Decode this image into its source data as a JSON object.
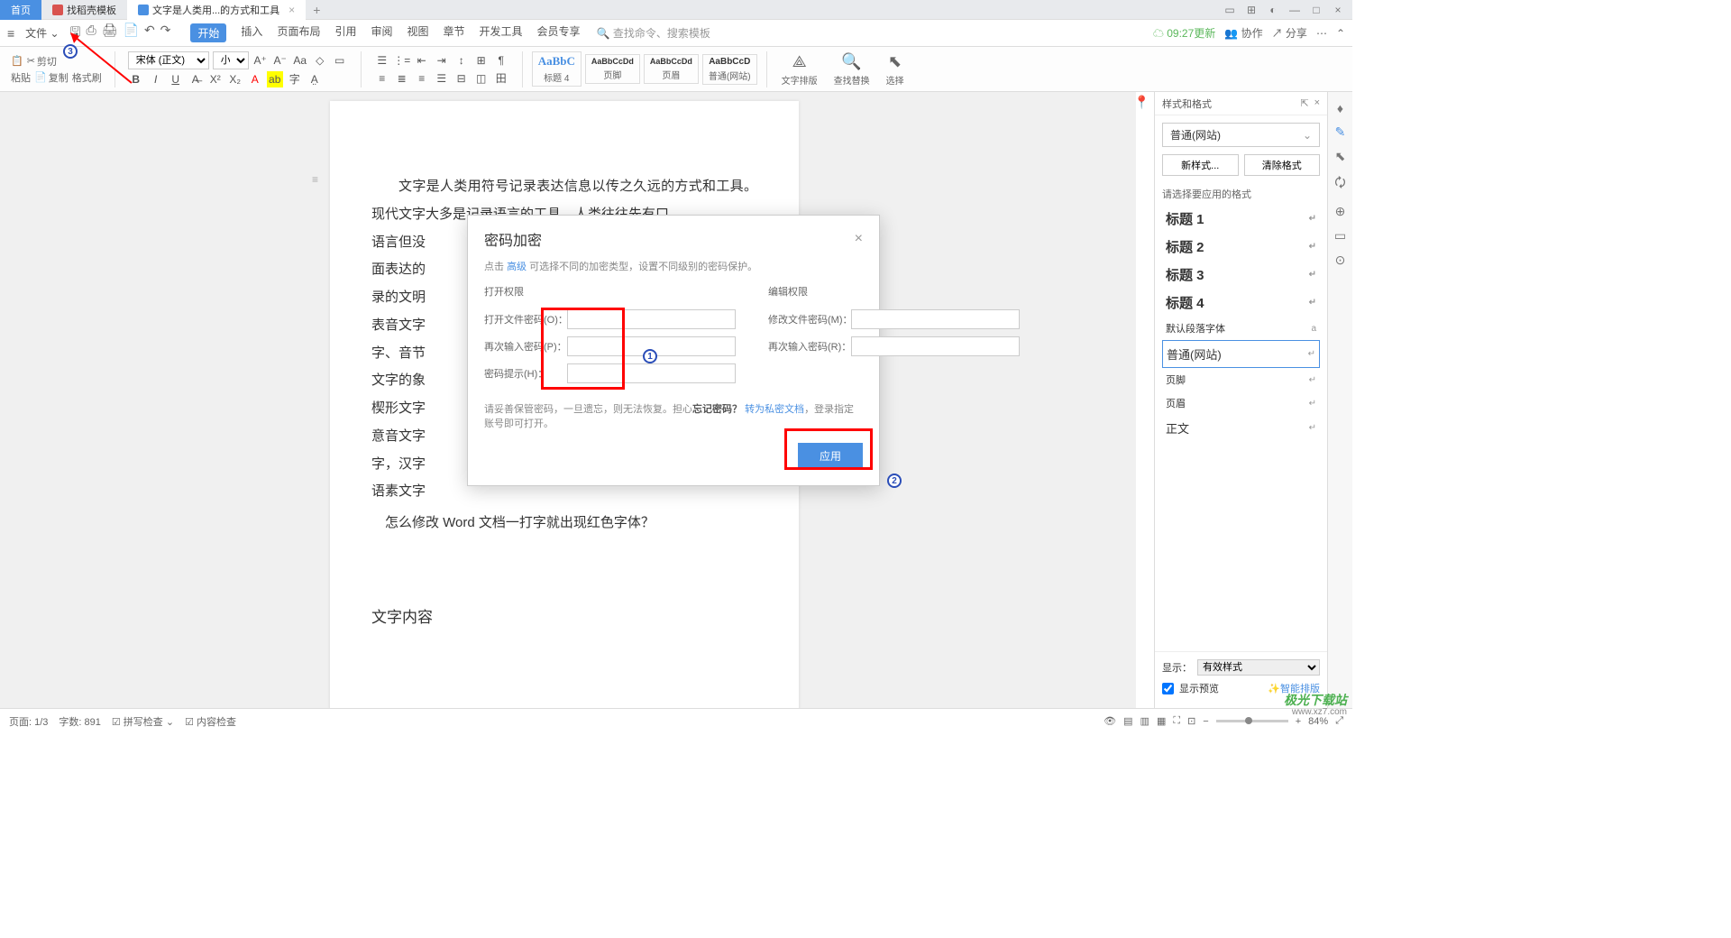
{
  "tabs": {
    "home": "首页",
    "templates": "找稻壳模板",
    "doc": "文字是人类用...的方式和工具"
  },
  "menubar": {
    "file": "文件",
    "items": [
      "开始",
      "插入",
      "页面布局",
      "引用",
      "审阅",
      "视图",
      "章节",
      "开发工具",
      "会员专享"
    ],
    "search": "查找命令、搜索模板",
    "update": "09:27更新",
    "coop": "协作",
    "share": "分享"
  },
  "ribbon": {
    "paste": "粘贴",
    "cut": "剪切",
    "copy": "复制",
    "brush": "格式刷",
    "font": "宋体 (正文)",
    "size": "小二",
    "styles": {
      "h4": {
        "preview": "AaBbC",
        "label": "标题 4"
      },
      "footer": {
        "preview": "AaBbCcDd",
        "label": "页脚"
      },
      "header": {
        "preview": "AaBbCcDd",
        "label": "页眉"
      },
      "normal": {
        "preview": "AaBbCcD",
        "label": "普通(网站)"
      }
    },
    "layout": "文字排版",
    "find": "查找替换",
    "select": "选择"
  },
  "doc": {
    "p1": "文字是人类用符号记录表达信息以传之久远的方式和工具。现代文字大多是记录语言的工具。人类往往先有口",
    "p2": "语言但没",
    "p3": "面表达的",
    "p4": "录的文明",
    "p5": "表音文字",
    "p6": "字、音节",
    "p7": "文字的象",
    "p8": "楔形文字",
    "p9": "意音文字",
    "p10": "字，汉字",
    "p11": "语素文字",
    "q": "怎么修改 Word 文档一打字就出现红色字体？",
    "h": "文字内容"
  },
  "dialog": {
    "title": "密码加密",
    "sub_pre": "点击 ",
    "sub_link": "高级",
    "sub_post": " 可选择不同的加密类型，设置不同级别的密码保护。",
    "open_section": "打开权限",
    "edit_section": "编辑权限",
    "open_pwd": "打开文件密码(O)：",
    "open_pwd2": "再次输入密码(P)：",
    "hint": "密码提示(H)：",
    "edit_pwd": "修改文件密码(M)：",
    "edit_pwd2": "再次输入密码(R)：",
    "warn_pre": "请妥善保管密码，一旦遗忘，则无法恢复。担心",
    "warn_bold": "忘记密码？",
    "warn_link": "转为私密文档",
    "warn_post": "，登录指定账号即可打开。",
    "apply": "应用"
  },
  "panel": {
    "title": "样式和格式",
    "current": "普通(网站)",
    "new_style": "新样式...",
    "clear": "清除格式",
    "choose": "请选择要应用的格式",
    "items": [
      "标题 1",
      "标题 2",
      "标题 3",
      "标题 4"
    ],
    "para_font": "默认段落字体",
    "selected": "普通(网站)",
    "extra": [
      "页脚",
      "页眉",
      "正文"
    ],
    "show": "显示：",
    "show_val": "有效样式",
    "preview": "显示预览",
    "smart": "智能排版"
  },
  "statusbar": {
    "page": "页面: 1/3",
    "words": "字数: 891",
    "spell": "拼写检查",
    "content": "内容检查",
    "zoom": "84%"
  },
  "watermark": {
    "logo": "极光下载站",
    "url": "www.xz7.com"
  }
}
